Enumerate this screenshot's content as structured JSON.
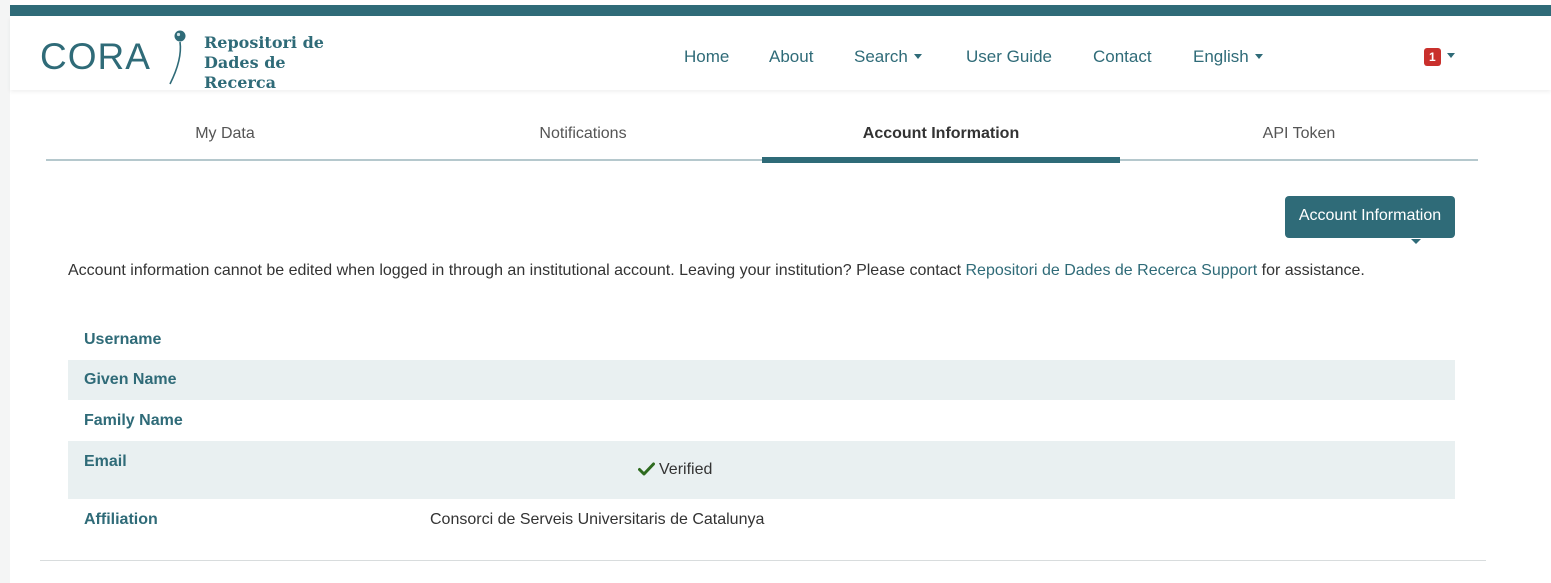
{
  "header": {
    "brand_logo": "CORA",
    "brand_line1": "Repositori de",
    "brand_line2": "Dades de Recerca",
    "nav": [
      {
        "label": "Home"
      },
      {
        "label": "About"
      },
      {
        "label": "Search"
      },
      {
        "label": "User Guide"
      },
      {
        "label": "Contact"
      },
      {
        "label": "English"
      }
    ],
    "notification_count": "1"
  },
  "tabs": [
    {
      "label": "My Data"
    },
    {
      "label": "Notifications"
    },
    {
      "label": "Account Information",
      "active": true
    },
    {
      "label": "API Token"
    }
  ],
  "account_button": {
    "label": "Account Information"
  },
  "info": {
    "text_before": "Account information cannot be edited when logged in through an institutional account. Leaving your institution? Please contact ",
    "link": "Repositori de Dades de Recerca Support",
    "text_after": " for assistance."
  },
  "fields": [
    {
      "label": "Username",
      "value": ""
    },
    {
      "label": "Given Name",
      "value": ""
    },
    {
      "label": "Family Name",
      "value": ""
    },
    {
      "label": "Email",
      "value": "",
      "status": "Verified"
    },
    {
      "label": "Affiliation",
      "value": "Consorci de Serveis Universitaris de Catalunya"
    }
  ],
  "colors": {
    "brand": "#2f6b78",
    "verified": "#2e6b1f",
    "badge": "#c9302c",
    "row_shade": "#e9f0f1"
  },
  "icons": {
    "verified": "check-icon",
    "dropdown": "caret-down-icon"
  }
}
